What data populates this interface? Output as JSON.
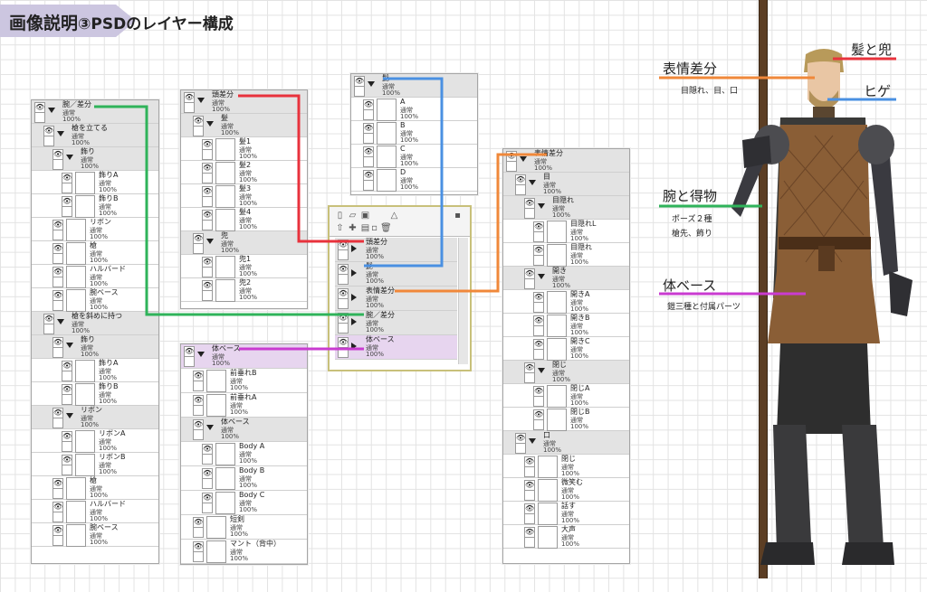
{
  "title": {
    "main": "画像説明",
    "rest": "③PSDのレイヤー構成"
  },
  "layer_props": {
    "mode": "通常",
    "opacity": "100%"
  },
  "panel1": [
    {
      "name": "腕／差分",
      "folder": true,
      "indent": 0
    },
    {
      "name": "槍を立てる",
      "folder": true,
      "indent": 1
    },
    {
      "name": "飾り",
      "folder": true,
      "indent": 2
    },
    {
      "name": "飾りA",
      "indent": 3
    },
    {
      "name": "飾りB",
      "indent": 3
    },
    {
      "name": "リボン",
      "indent": 2
    },
    {
      "name": "槍",
      "indent": 2
    },
    {
      "name": "ハルバード",
      "indent": 2
    },
    {
      "name": "腕ベース",
      "indent": 2
    },
    {
      "name": "槍を斜めに持つ",
      "folder": true,
      "indent": 1
    },
    {
      "name": "飾り",
      "folder": true,
      "indent": 2
    },
    {
      "name": "飾りA",
      "indent": 3
    },
    {
      "name": "飾りB",
      "indent": 3
    },
    {
      "name": "リボン",
      "folder": true,
      "indent": 2
    },
    {
      "name": "リボンA",
      "indent": 3
    },
    {
      "name": "リボンB",
      "indent": 3
    },
    {
      "name": "槍",
      "indent": 2
    },
    {
      "name": "ハルバード",
      "indent": 2
    },
    {
      "name": "腕ベース",
      "indent": 2
    }
  ],
  "panel2": [
    {
      "name": "頭差分",
      "folder": true,
      "indent": 0
    },
    {
      "name": "髪",
      "folder": true,
      "indent": 1
    },
    {
      "name": "髪1",
      "indent": 2
    },
    {
      "name": "髪2",
      "indent": 2
    },
    {
      "name": "髪3",
      "indent": 2
    },
    {
      "name": "髪4",
      "indent": 2
    },
    {
      "name": "兜",
      "folder": true,
      "indent": 1
    },
    {
      "name": "兜1",
      "indent": 2
    },
    {
      "name": "兜2",
      "indent": 2
    }
  ],
  "panel3": [
    {
      "name": "髭",
      "folder": true,
      "indent": 0
    },
    {
      "name": "A",
      "indent": 1
    },
    {
      "name": "B",
      "indent": 1
    },
    {
      "name": "C",
      "indent": 1
    },
    {
      "name": "D",
      "indent": 1
    }
  ],
  "panel4": [
    {
      "name": "体ベース",
      "folder": true,
      "indent": 0,
      "sel": true
    },
    {
      "name": "前垂れB",
      "indent": 1
    },
    {
      "name": "前垂れA",
      "indent": 1
    },
    {
      "name": "体ベース",
      "folder": true,
      "indent": 1
    },
    {
      "name": "Body A",
      "indent": 2
    },
    {
      "name": "Body  B",
      "indent": 2
    },
    {
      "name": "Body   C",
      "indent": 2
    },
    {
      "name": "短剣",
      "indent": 1
    },
    {
      "name": "マント（背中）",
      "indent": 1
    }
  ],
  "panel5": [
    {
      "name": "表情差分",
      "folder": true,
      "indent": 0
    },
    {
      "name": "目",
      "folder": true,
      "indent": 1
    },
    {
      "name": "目隠れ",
      "folder": true,
      "indent": 2
    },
    {
      "name": "目隠れL",
      "indent": 3
    },
    {
      "name": "目隠れ",
      "indent": 3
    },
    {
      "name": "開き",
      "folder": true,
      "indent": 2
    },
    {
      "name": "開きA",
      "indent": 3
    },
    {
      "name": "開きB",
      "indent": 3
    },
    {
      "name": "開きC",
      "indent": 3
    },
    {
      "name": "閉じ",
      "folder": true,
      "indent": 2
    },
    {
      "name": "閉じA",
      "indent": 3
    },
    {
      "name": "閉じB",
      "indent": 3
    },
    {
      "name": "口",
      "folder": true,
      "indent": 1
    },
    {
      "name": "閉じ",
      "indent": 2
    },
    {
      "name": "微笑む",
      "indent": 2
    },
    {
      "name": "話す",
      "indent": 2
    },
    {
      "name": "大声",
      "indent": 2
    }
  ],
  "center_panel": [
    {
      "name": "頭差分"
    },
    {
      "name": "髭"
    },
    {
      "name": "表情差分"
    },
    {
      "name": "腕／差分"
    },
    {
      "name": "体ベース",
      "sel": true
    }
  ],
  "annotations": {
    "kabuto": "髪と兜",
    "hyojo": "表情差分",
    "hyojo_sub": "目隠れ、目、口",
    "hige": "ヒゲ",
    "ude": "腕と得物",
    "ude_sub1": "ポーズ２種",
    "ude_sub2": "槍先、飾り",
    "karada": "体ベース",
    "karada_sub": "鎧三種と付属パーツ"
  },
  "colors": {
    "red": "#e8323c",
    "blue": "#4a90e2",
    "orange": "#f0883a",
    "green": "#2fb35a",
    "magenta": "#c93bd0",
    "banner": "#ccc6e0"
  }
}
